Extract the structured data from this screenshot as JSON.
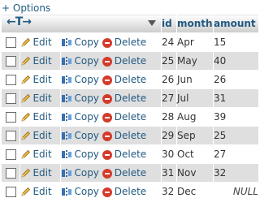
{
  "options_link": "+ Options",
  "header": {
    "nav_arrows": "←T→",
    "columns": [
      "id",
      "month",
      "amount"
    ]
  },
  "actions": {
    "edit": "Edit",
    "copy": "Copy",
    "delete": "Delete"
  },
  "rows": [
    {
      "id": "24",
      "month": "Apr",
      "amount": "15"
    },
    {
      "id": "25",
      "month": "May",
      "amount": "40"
    },
    {
      "id": "26",
      "month": "Jun",
      "amount": "26"
    },
    {
      "id": "27",
      "month": "Jul",
      "amount": "31"
    },
    {
      "id": "28",
      "month": "Aug",
      "amount": "39"
    },
    {
      "id": "29",
      "month": "Sep",
      "amount": "25"
    },
    {
      "id": "30",
      "month": "Oct",
      "amount": "27"
    },
    {
      "id": "31",
      "month": "Nov",
      "amount": "32"
    },
    {
      "id": "32",
      "month": "Dec",
      "amount": "NULL"
    }
  ],
  "colors": {
    "link": "#235a81",
    "row_alt": "#dfdfdf",
    "delete_icon": "#d43b2a"
  }
}
